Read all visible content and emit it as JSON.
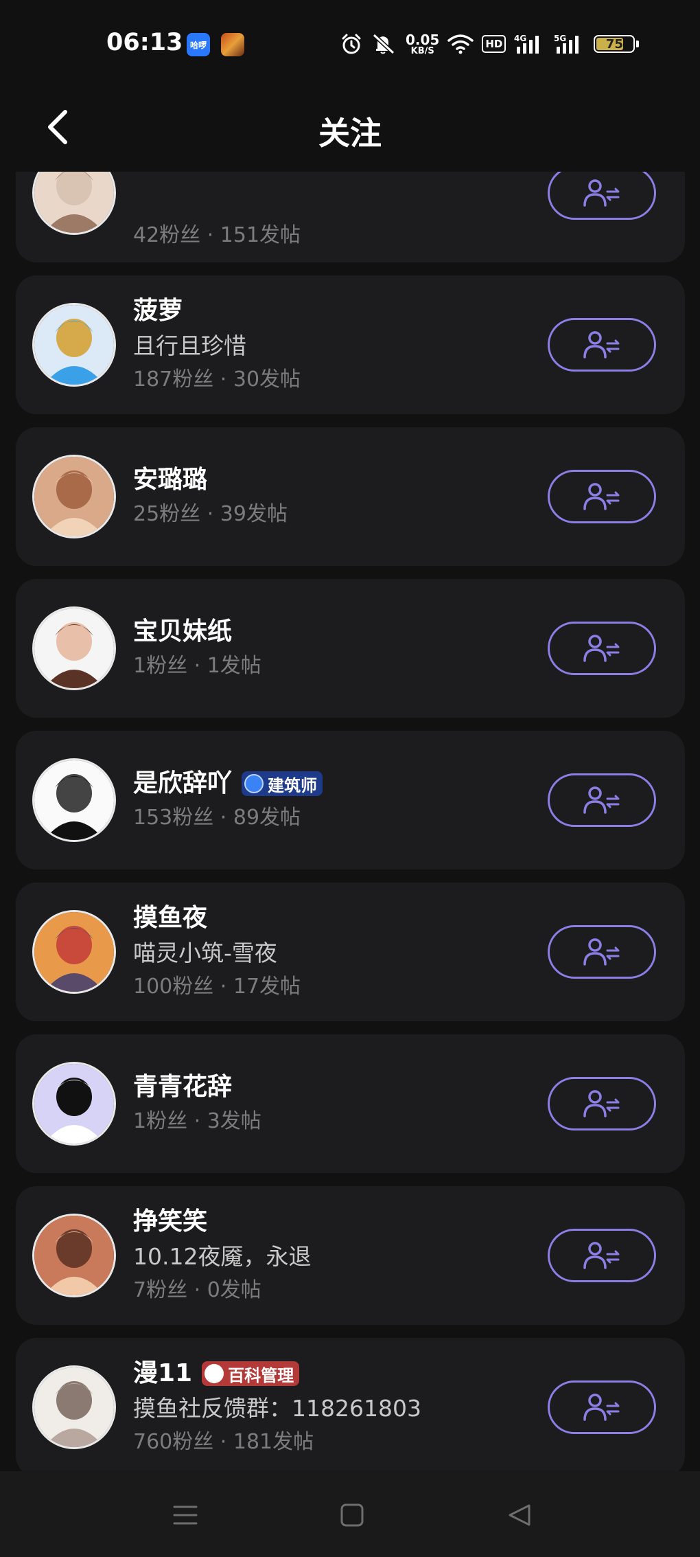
{
  "status": {
    "time": "06:13",
    "app_icons": [
      "哈啰",
      ""
    ],
    "net_speed_value": "0.05",
    "net_speed_unit": "KB/S",
    "hd_label": "HD",
    "signal_4g": "4G",
    "signal_5g": "5G",
    "battery": "75",
    "battery_level": 0.75,
    "icons": [
      "alarm-icon",
      "mute-icon",
      "wifi-icon",
      "signal-4g-icon",
      "signal-5g-icon",
      "battery-icon"
    ]
  },
  "header": {
    "title": "关注",
    "back_icon": "chevron-left-icon"
  },
  "colors": {
    "background": "#111111",
    "card": "#1c1c1e",
    "accent": "#8b7fe6",
    "stats": "#7c7c7c"
  },
  "follow_icon": "user-mutual-follow-icon",
  "users": [
    {
      "name": "",
      "signature": "",
      "stats": "42粉丝 · 151发帖",
      "badge": null
    },
    {
      "name": "菠萝",
      "signature": "且行且珍惜",
      "stats": "187粉丝 · 30发帖",
      "badge": null
    },
    {
      "name": "安璐璐",
      "signature": "",
      "stats": "25粉丝 · 39发帖",
      "badge": null
    },
    {
      "name": "宝贝妹纸",
      "signature": "",
      "stats": "1粉丝 · 1发帖",
      "badge": null
    },
    {
      "name": "是欣辞吖",
      "signature": "",
      "stats": "153粉丝 · 89发帖",
      "badge": {
        "label": "建筑师",
        "style": "blue"
      }
    },
    {
      "name": "摸鱼夜",
      "signature": "喵灵小筑-雪夜",
      "stats": "100粉丝 · 17发帖",
      "badge": null
    },
    {
      "name": "青青花辞",
      "signature": "",
      "stats": "1粉丝 · 3发帖",
      "badge": null
    },
    {
      "name": "挣笑笑",
      "signature": "10.12夜魇，永退",
      "stats": "7粉丝 · 0发帖",
      "badge": null
    },
    {
      "name": "漫11",
      "signature": "摸鱼社反馈群：118261803",
      "stats": "760粉丝 · 181发帖",
      "badge": {
        "label": "百科管理",
        "style": "red"
      }
    }
  ],
  "nav": {
    "menu_icon": "menu-icon",
    "home_icon": "home-square-icon",
    "back_icon": "back-triangle-icon"
  }
}
